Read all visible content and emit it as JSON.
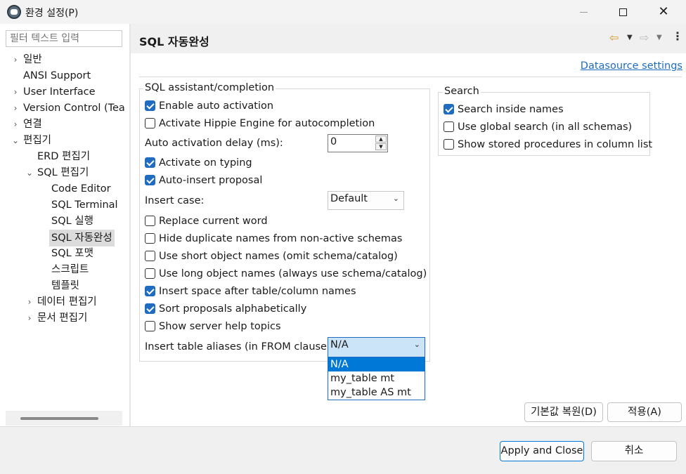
{
  "window": {
    "title": "환경 설정(P)",
    "icon": "dbeaver-icon"
  },
  "filter": {
    "placeholder": "필터 텍스트 입력"
  },
  "tree": [
    {
      "label": "일반",
      "expandable": true
    },
    {
      "label": "ANSI Support",
      "expandable": false
    },
    {
      "label": "User Interface",
      "expandable": true
    },
    {
      "label": "Version Control (Tea",
      "expandable": true
    },
    {
      "label": "연결",
      "expandable": true
    },
    {
      "label": "편집기",
      "expandable": true,
      "expanded": true
    },
    {
      "label": "ERD 편집기",
      "expandable": false
    },
    {
      "label": "SQL 편집기",
      "expandable": true,
      "expanded": true
    },
    {
      "label": "Code Editor",
      "expandable": false
    },
    {
      "label": "SQL Terminal",
      "expandable": false
    },
    {
      "label": "SQL 실행",
      "expandable": false
    },
    {
      "label": "SQL 자동완성",
      "expandable": false,
      "selected": true
    },
    {
      "label": "SQL 포맷",
      "expandable": false
    },
    {
      "label": "스크립트",
      "expandable": false
    },
    {
      "label": "템플릿",
      "expandable": false
    },
    {
      "label": "데이터 편집기",
      "expandable": true
    },
    {
      "label": "문서 편집기",
      "expandable": true
    }
  ],
  "page": {
    "title": "SQL 자동완성",
    "datasource_link": "Datasource settings"
  },
  "assist_group": {
    "title": "SQL assistant/completion",
    "enable_auto_activation": {
      "label": "Enable auto activation",
      "checked": true
    },
    "hippie": {
      "label": "Activate Hippie Engine for autocompletion",
      "checked": false
    },
    "delay_label": "Auto activation delay (ms):",
    "delay_value": "0",
    "activate_typing": {
      "label": "Activate on typing",
      "checked": true
    },
    "auto_insert": {
      "label": "Auto-insert proposal",
      "checked": true
    },
    "insert_case_label": "Insert case:",
    "insert_case_value": "Default",
    "replace_word": {
      "label": "Replace current word",
      "checked": false
    },
    "hide_dupes": {
      "label": "Hide duplicate names from non-active schemas",
      "checked": false
    },
    "short_names": {
      "label": "Use short object names (omit schema/catalog)",
      "checked": false
    },
    "long_names": {
      "label": "Use long object names (always use schema/catalog)",
      "checked": false
    },
    "insert_space": {
      "label": "Insert space after table/column names",
      "checked": true
    },
    "sort_alpha": {
      "label": "Sort proposals alphabetically",
      "checked": true
    },
    "server_help": {
      "label": "Show server help topics",
      "checked": false
    },
    "aliases_label": "Insert table aliases (in FROM clause):",
    "aliases_value": "N/A",
    "aliases_options": [
      "N/A",
      "my_table mt",
      "my_table AS mt"
    ]
  },
  "search_group": {
    "title": "Search",
    "inside_names": {
      "label": "Search inside names",
      "checked": true
    },
    "global_search": {
      "label": "Use global search (in all schemas)",
      "checked": false
    },
    "stored_procs": {
      "label": "Show stored procedures in column list",
      "checked": false
    }
  },
  "buttons": {
    "restore_defaults": "기본값 복원(D)",
    "apply": "적용(A)",
    "apply_close": "Apply and Close",
    "cancel": "취소"
  },
  "colors": {
    "accent": "#1f6cc0",
    "selection": "#0078d7",
    "nav_back": "#d39a22"
  }
}
